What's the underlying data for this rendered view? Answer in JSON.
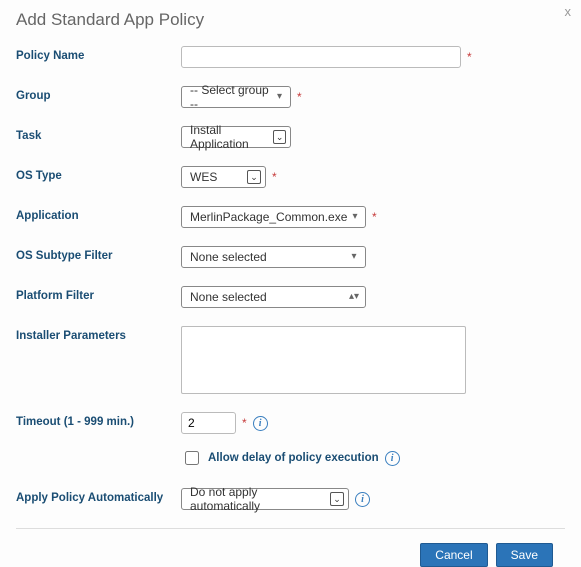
{
  "dialog": {
    "title": "Add Standard App Policy",
    "close_label": "x"
  },
  "labels": {
    "policy_name": "Policy Name",
    "group": "Group",
    "task": "Task",
    "os_type": "OS Type",
    "application": "Application",
    "os_subtype_filter": "OS Subtype Filter",
    "platform_filter": "Platform Filter",
    "installer_parameters": "Installer Parameters",
    "timeout": "Timeout (1 - 999 min.)",
    "allow_delay": "Allow delay of policy execution",
    "apply_auto": "Apply Policy Automatically"
  },
  "fields": {
    "policy_name": "",
    "group": "-- Select group --",
    "task": "Install Application",
    "os_type": "WES",
    "application": "MerlinPackage_Common.exe (Loc",
    "os_subtype_filter": "None selected",
    "platform_filter": "None selected",
    "installer_parameters": "",
    "timeout": "2",
    "allow_delay_checked": false,
    "apply_auto": "Do not apply automatically"
  },
  "required_mark": "*",
  "buttons": {
    "cancel": "Cancel",
    "save": "Save"
  },
  "icons": {
    "info": "i"
  }
}
